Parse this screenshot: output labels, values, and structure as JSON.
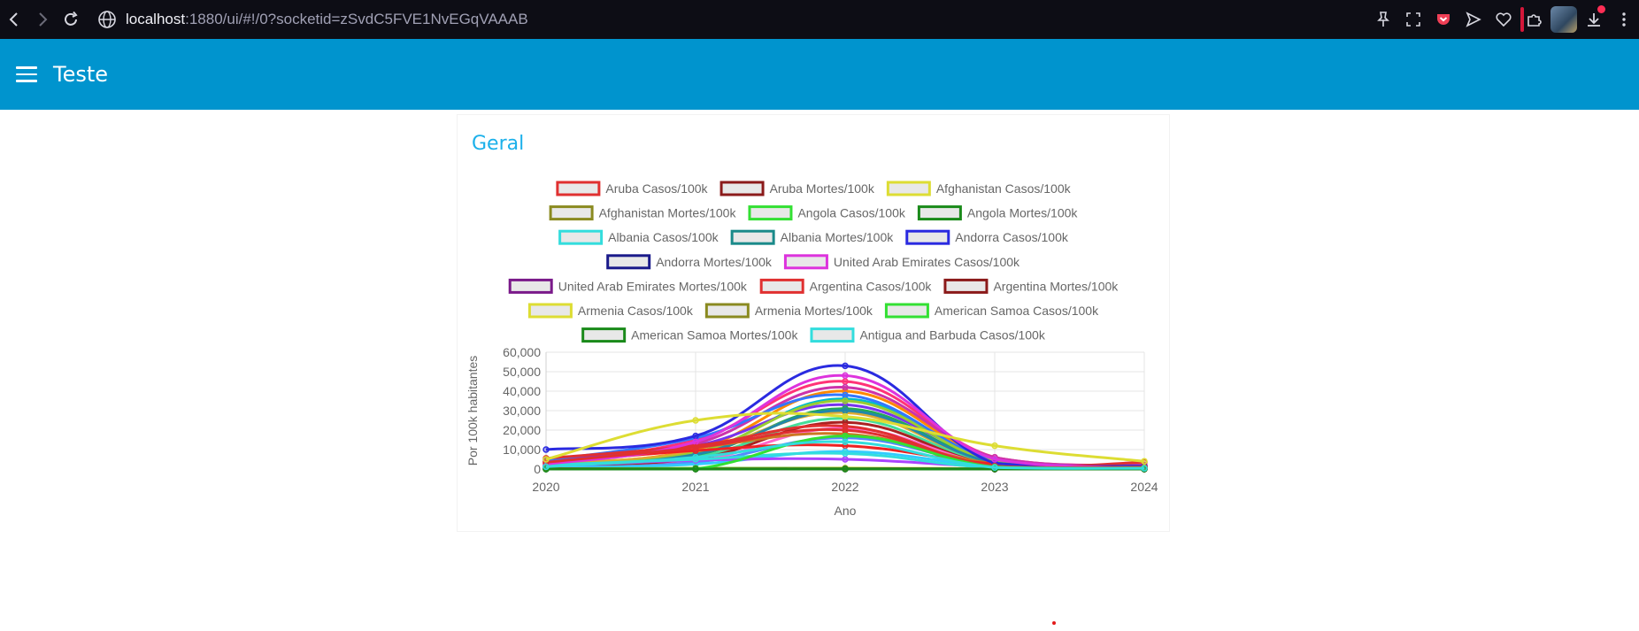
{
  "browser": {
    "url_host": "localhost",
    "url_rest": ":1880/ui/#!/0?socketid=zSvdC5FVE1NvEGqVAAAB"
  },
  "app": {
    "title": "Teste",
    "card_title": "Geral"
  },
  "colors": {
    "appbar": "#0094ce",
    "card_title": "#1bb0ea"
  },
  "chart_data": {
    "type": "line",
    "xlabel": "Ano",
    "ylabel": "Por 100k habitantes",
    "x": [
      "2020",
      "2021",
      "2022",
      "2023",
      "2024"
    ],
    "ylim": [
      0,
      60000
    ],
    "yticks": [
      "0",
      "10,000",
      "20,000",
      "30,000",
      "40,000",
      "50,000",
      "60,000"
    ],
    "legend_position": "top",
    "grid": true,
    "series": [
      {
        "name": "Aruba Casos/100k",
        "color": "#e03030",
        "values": [
          5500,
          12000,
          22000,
          1200,
          3500
        ]
      },
      {
        "name": "Aruba Mortes/100k",
        "color": "#8b1a1a",
        "values": [
          20,
          60,
          80,
          20,
          10
        ]
      },
      {
        "name": "Afghanistan Casos/100k",
        "color": "#dddd33",
        "values": [
          100,
          300,
          500,
          200,
          100
        ]
      },
      {
        "name": "Afghanistan Mortes/100k",
        "color": "#8a8a20",
        "values": [
          5,
          10,
          10,
          5,
          2
        ]
      },
      {
        "name": "Angola Casos/100k",
        "color": "#33e033",
        "values": [
          50,
          400,
          300,
          100,
          50
        ]
      },
      {
        "name": "Angola Mortes/100k",
        "color": "#1a8a1a",
        "values": [
          2,
          10,
          5,
          2,
          1
        ]
      },
      {
        "name": "Albania Casos/100k",
        "color": "#33dddd",
        "values": [
          2000,
          5000,
          8000,
          500,
          300
        ]
      },
      {
        "name": "Albania Mortes/100k",
        "color": "#1a8a8a",
        "values": [
          30,
          80,
          60,
          10,
          5
        ]
      },
      {
        "name": "Andorra Casos/100k",
        "color": "#2a2ae0",
        "values": [
          10000,
          17000,
          53000,
          3000,
          1500
        ]
      },
      {
        "name": "Andorra Mortes/100k",
        "color": "#1a1a8a",
        "values": [
          100,
          200,
          150,
          20,
          10
        ]
      },
      {
        "name": "United Arab Emirates Casos/100k",
        "color": "#dd33dd",
        "values": [
          2500,
          14000,
          48000,
          5000,
          500
        ]
      },
      {
        "name": "United Arab Emirates Mortes/100k",
        "color": "#7a1a8a",
        "values": [
          10,
          60,
          80,
          10,
          5
        ]
      },
      {
        "name": "Argentina Casos/100k",
        "color": "#e03030",
        "values": [
          3500,
          11000,
          20000,
          1500,
          1000
        ]
      },
      {
        "name": "Argentina Mortes/100k",
        "color": "#8b1a1a",
        "values": [
          90,
          200,
          150,
          20,
          10
        ]
      },
      {
        "name": "Armenia Casos/100k",
        "color": "#dddd33",
        "values": [
          5000,
          25000,
          27000,
          12000,
          4000
        ]
      },
      {
        "name": "Armenia Mortes/100k",
        "color": "#8a8a20",
        "values": [
          100,
          300,
          200,
          50,
          20
        ]
      },
      {
        "name": "American Samoa Casos/100k",
        "color": "#33e033",
        "values": [
          0,
          100,
          17000,
          1000,
          500
        ]
      },
      {
        "name": "American Samoa Mortes/100k",
        "color": "#1a8a1a",
        "values": [
          0,
          5,
          40,
          10,
          5
        ]
      },
      {
        "name": "Antigua and Barbuda Casos/100k",
        "color": "#33dddd",
        "values": [
          1200,
          6000,
          14000,
          800,
          400
        ]
      }
    ],
    "background_series_colors": [
      "#ff3377",
      "#ff8800",
      "#00bbcc",
      "#7733ee",
      "#22aa55",
      "#e0aa33",
      "#cc33aa",
      "#44dd99",
      "#3377ff",
      "#aa2222",
      "#99cc33",
      "#ff66cc",
      "#2288aa",
      "#cc7722",
      "#5588ff",
      "#ee2222",
      "#33ccff",
      "#aa44ff"
    ],
    "background_series": [
      [
        4000,
        15000,
        45000,
        6000,
        2000
      ],
      [
        3000,
        10000,
        40000,
        5000,
        1500
      ],
      [
        2000,
        8000,
        36000,
        4000,
        1000
      ],
      [
        5000,
        12000,
        33000,
        5000,
        1200
      ],
      [
        1500,
        7000,
        31000,
        3500,
        1000
      ],
      [
        2500,
        9000,
        29000,
        3000,
        800
      ],
      [
        3500,
        13000,
        42000,
        6000,
        1800
      ],
      [
        1000,
        6000,
        26000,
        2500,
        700
      ],
      [
        4500,
        16000,
        38000,
        4500,
        1500
      ],
      [
        800,
        5000,
        24000,
        2000,
        600
      ],
      [
        2200,
        8500,
        35000,
        3800,
        1100
      ],
      [
        600,
        4000,
        21000,
        2200,
        600
      ],
      [
        1800,
        7500,
        30000,
        3200,
        900
      ],
      [
        3200,
        11000,
        18000,
        2800,
        800
      ],
      [
        900,
        3500,
        16000,
        1800,
        500
      ],
      [
        2800,
        9500,
        12000,
        2600,
        700
      ],
      [
        500,
        2500,
        9000,
        1500,
        400
      ],
      [
        1400,
        4500,
        5000,
        1200,
        300
      ]
    ]
  }
}
